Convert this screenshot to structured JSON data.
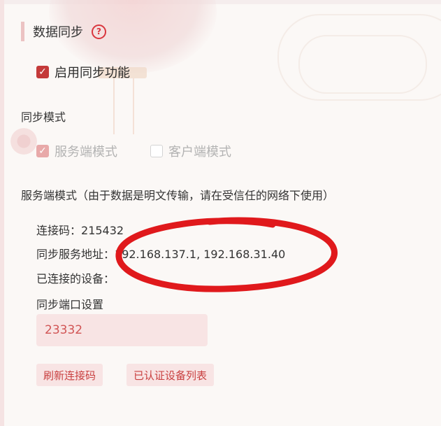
{
  "section": {
    "title": "数据同步",
    "help_icon": "question-circle-icon"
  },
  "enable_sync": {
    "label": "启用同步功能",
    "checked": true
  },
  "sync_mode": {
    "heading": "同步模式",
    "options": [
      {
        "label": "服务端模式",
        "checked": true,
        "disabled": true
      },
      {
        "label": "客户端模式",
        "checked": false,
        "disabled": true
      }
    ]
  },
  "server_mode": {
    "heading": "服务端模式（由于数据是明文传输，请在受信任的网络下使用）",
    "connect_code_label": "连接码：",
    "connect_code_value": "215432",
    "server_address_label": "同步服务地址：",
    "server_address_value": "192.168.137.1, 192.168.31.40",
    "connected_devices_label": "已连接的设备：",
    "port_label": "同步端口设置",
    "port_value": "23332"
  },
  "buttons": {
    "refresh_code": "刷新连接码",
    "authorized_devices": "已认证设备列表"
  },
  "colors": {
    "accent": "#c43a3a",
    "button_bg": "#f8e4e4",
    "annotation": "#e0191c"
  }
}
